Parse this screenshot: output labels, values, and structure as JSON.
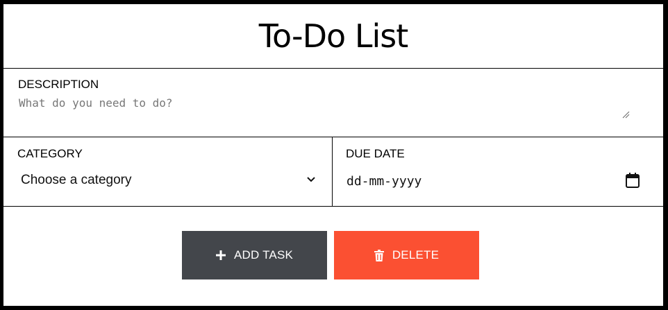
{
  "header": {
    "title": "To-Do List"
  },
  "description": {
    "label": "DESCRIPTION",
    "placeholder": "What do you need to do?",
    "value": ""
  },
  "category": {
    "label": "CATEGORY",
    "selected": "Choose a category",
    "icon": "chevron-down-icon"
  },
  "due_date": {
    "label": "DUE DATE",
    "value": "dd-mm-yyyy",
    "icon": "calendar-icon"
  },
  "actions": {
    "add_label": "ADD TASK",
    "add_icon": "plus-icon",
    "add_color": "#43464b",
    "delete_label": "DELETE",
    "delete_icon": "trash-icon",
    "delete_color": "#fb5032"
  }
}
